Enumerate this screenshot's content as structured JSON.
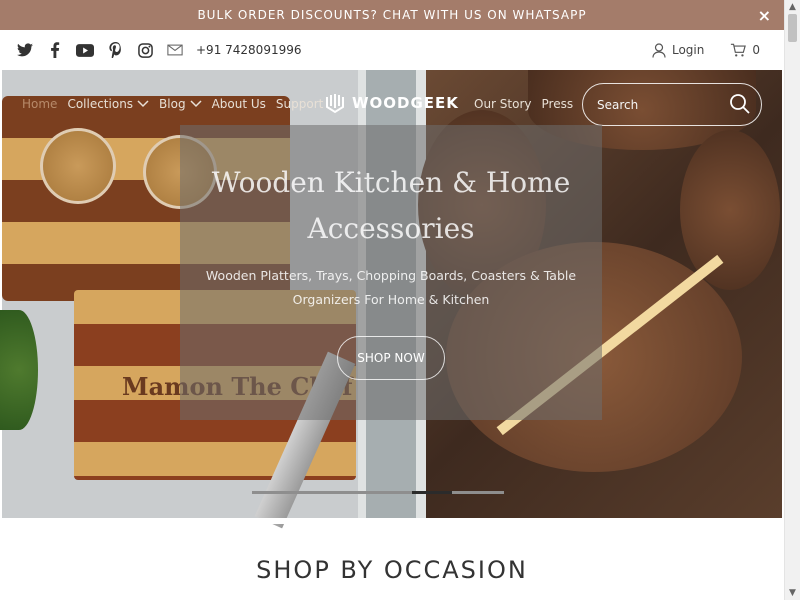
{
  "announcement": {
    "text": "BULK ORDER DISCOUNTS? CHAT WITH US ON WHATSAPP",
    "close": "×"
  },
  "topbar": {
    "social": [
      "twitter-icon",
      "facebook-icon",
      "youtube-icon",
      "pinterest-icon",
      "instagram-icon",
      "mail-icon"
    ],
    "phone": "+91 7428091996",
    "login_label": "Login",
    "cart_count": "0"
  },
  "nav": {
    "left": [
      {
        "label": "Home"
      },
      {
        "label": "Collections"
      },
      {
        "label": "Blog"
      },
      {
        "label": "About Us"
      },
      {
        "label": "Support"
      }
    ],
    "logo": "WOODGEEK",
    "right": [
      {
        "label": "Our Story"
      },
      {
        "label": "Press"
      }
    ],
    "search_placeholder": "Search"
  },
  "hero": {
    "title": "Wooden Kitchen & Home Accessories",
    "subtitle": "Wooden Platters, Trays, Chopping Boards, Coasters & Table Organizers For Home & Kitchen",
    "button": "SHOP NOW",
    "board_text": "Mamon The Chef"
  },
  "section": {
    "title": "SHOP BY OCCASION"
  },
  "colors": {
    "announcement_bg": "#a47c6a",
    "home_link": "#b78a6a"
  }
}
